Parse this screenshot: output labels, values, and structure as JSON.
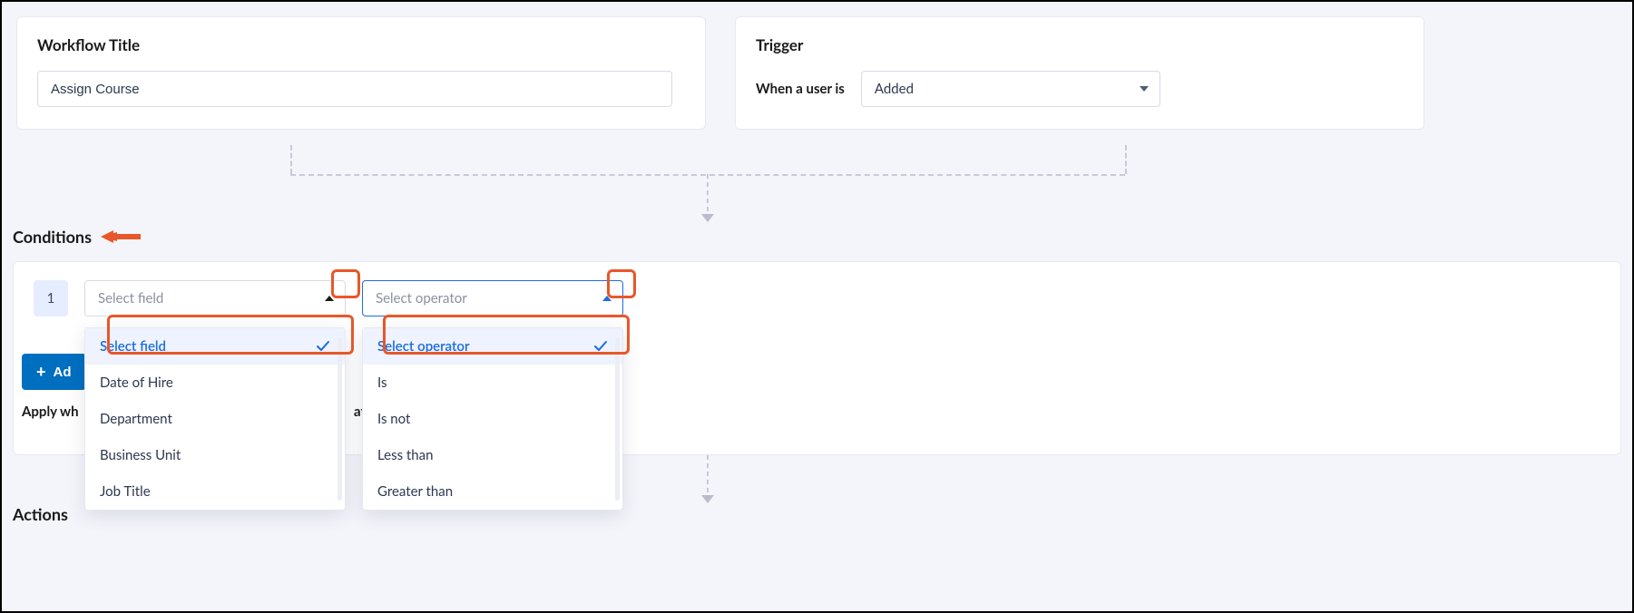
{
  "workflow": {
    "title_label": "Workflow Title",
    "title_value": "Assign Course"
  },
  "trigger": {
    "title_label": "Trigger",
    "prefix_label": "When a user is",
    "selected_value": "Added"
  },
  "conditions": {
    "section_label": "Conditions",
    "row_number": "1",
    "field_placeholder": "Select field",
    "operator_placeholder": "Select operator",
    "field_options": {
      "selected": "Select field",
      "items": [
        "Date of Hire",
        "Department",
        "Business Unit",
        "Job Title"
      ]
    },
    "operator_options": {
      "selected": "Select operator",
      "items": [
        "Is",
        "Is not",
        "Less than",
        "Greater than"
      ]
    },
    "add_button_label_partial": "Ad",
    "apply_label_head": "Apply wh",
    "apply_label_tail": "at"
  },
  "actions": {
    "section_label": "Actions"
  }
}
